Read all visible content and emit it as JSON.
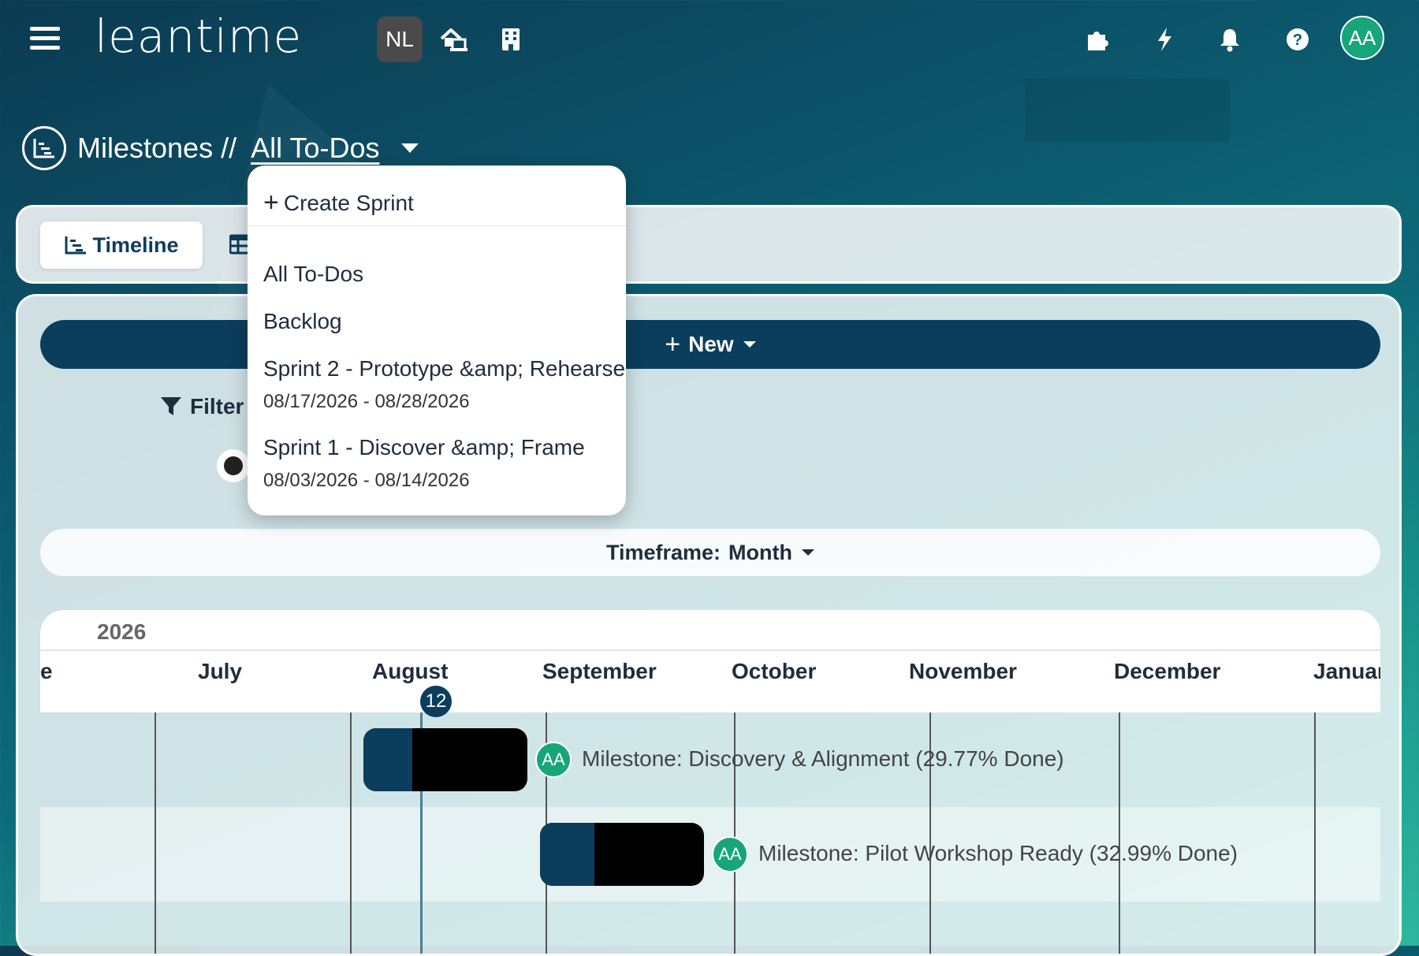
{
  "app": {
    "logo_text": "leantime",
    "project_badge": "NL",
    "user_initials": "AA"
  },
  "header": {
    "title": "Milestones",
    "separator": "//",
    "current_view": "All To-Dos"
  },
  "tabs": {
    "timeline_label": "Timeline"
  },
  "toolbar": {
    "new_label": "New",
    "filter_label": "Filter",
    "timeframe_label": "Timeframe:",
    "timeframe_value": "Month"
  },
  "dropdown": {
    "create_label": "Create Sprint",
    "items": [
      {
        "label": "All To-Dos"
      },
      {
        "label": "Backlog"
      },
      {
        "label": "Sprint 2 - Prototype &amp; Rehearse",
        "dates": "08/17/2026 - 08/28/2026"
      },
      {
        "label": "Sprint 1 - Discover &amp; Frame",
        "dates": "08/03/2026 - 08/14/2026"
      }
    ]
  },
  "gantt": {
    "year": "2026",
    "months": [
      "e",
      "July",
      "August",
      "September",
      "October",
      "November",
      "December",
      "Januar"
    ],
    "today_day": "12",
    "milestones": [
      {
        "initials": "AA",
        "label": "Milestone: Discovery & Alignment (29.77% Done)",
        "progress": 0.2977
      },
      {
        "initials": "AA",
        "label": "Milestone: Pilot Workshop Ready (32.99% Done)",
        "progress": 0.3299
      }
    ]
  },
  "colors": {
    "primary": "#0b3d5c",
    "accent": "#17a57a"
  }
}
